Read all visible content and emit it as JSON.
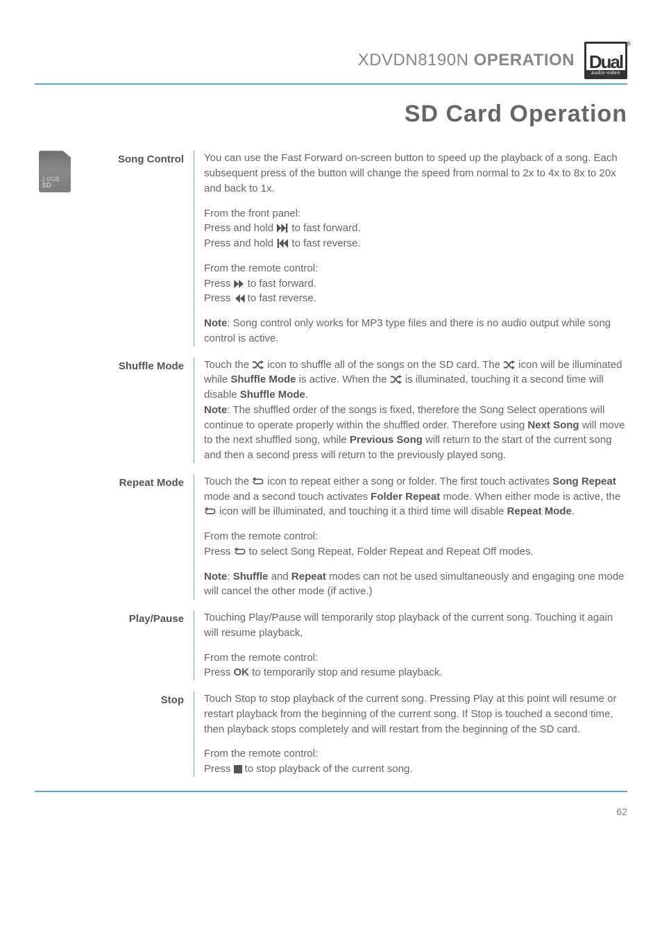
{
  "header": {
    "product": "XDVDN8190N",
    "section": "OPERATION",
    "logo_text": "Dual",
    "logo_subtext": "audio-video",
    "logo_reg": "®"
  },
  "page_title": "SD Card Operation",
  "sd_icon": {
    "capacity": "2.0GB",
    "label": "SD"
  },
  "sections": {
    "song_control": {
      "label": "Song Control",
      "p1": "You can use the Fast Forward on-screen button to speed up the playback of a song. Each subsequent press of the button will change the speed from normal to 2x to 4x to 8x to 20x and back to 1x.",
      "p2_intro": "From the front panel:",
      "p2_l1a": "Press and hold ",
      "p2_l1b": " to fast forward.",
      "p2_l2a": "Press and hold ",
      "p2_l2b": " to fast reverse.",
      "p3_intro": "From the remote control:",
      "p3_l1a": "Press ",
      "p3_l1b": " to fast forward.",
      "p3_l2a": "Press ",
      "p3_l2b": " to fast reverse.",
      "p4_b": "Note",
      "p4": ": Song control only works for MP3 type files and there is no audio output while song control is active."
    },
    "shuffle": {
      "label": "Shuffle Mode",
      "a1": "Touch the ",
      "a2": " icon to shuffle all of the songs on the SD card. The ",
      "a3": " icon will be illuminated while ",
      "a3b": "Shuffle Mode",
      "a4": " is active. When the ",
      "a5": " is illuminated, touching it a second time will disable ",
      "a5b": "Shuffle Mode",
      "a6": ".",
      "note_b": "Note",
      "note": ": The shuffled order of the songs is fixed, therefore the Song Select operations will continue to operate properly within the shuffled order. Therefore using ",
      "note_b2": "Next Song",
      "note2": " will move to the next shuffled song, while ",
      "note_b3": "Previous Song",
      "note3": " will return to the start of the current song and then a second press will return to the previously played song."
    },
    "repeat": {
      "label": "Repeat Mode",
      "a1": "Touch the ",
      "a2": " icon to repeat either a song or folder. The first touch activates ",
      "a2b": "Song Repeat",
      "a3": " mode and a second touch activates ",
      "a3b": "Folder Repeat",
      "a4": " mode. When either mode is active, the ",
      "a5": " icon will be illuminated, and touching it a third time will disable ",
      "a5b": "Repeat Mode",
      "a6": ".",
      "p2_intro": "From the remote control:",
      "p2_l1a": "Press ",
      "p2_l1b": " to select Song Repeat, Folder Repeat and Repeat Off modes.",
      "p3_b1": "Note",
      "p3_a": ": ",
      "p3_b2": "Shuffle",
      "p3_b": " and ",
      "p3_b3": "Repeat",
      "p3_c": " modes can not be used simultaneously and engaging one mode will cancel the other mode (if active.)"
    },
    "playpause": {
      "label": "Play/Pause",
      "p1": "Touching Play/Pause will temporarily stop playback of the current song. Touching it again will resume playback,",
      "p2_intro": "From the remote control:",
      "p2_l1a": "Press ",
      "p2_l1b": "OK",
      "p2_l1c": " to temporarily stop and resume playback."
    },
    "stop": {
      "label": "Stop",
      "p1": "Touch Stop to stop playback of the current song. Pressing Play at this point will resume or restart playback from the beginning of the current song. If Stop is touched a second time, then playback stops completely and will restart from the beginning of the SD card.",
      "p2_intro": "From the remote control:",
      "p2_l1a": "Press ",
      "p2_l1b": " to stop playback of the current song."
    }
  },
  "page_number": "62"
}
